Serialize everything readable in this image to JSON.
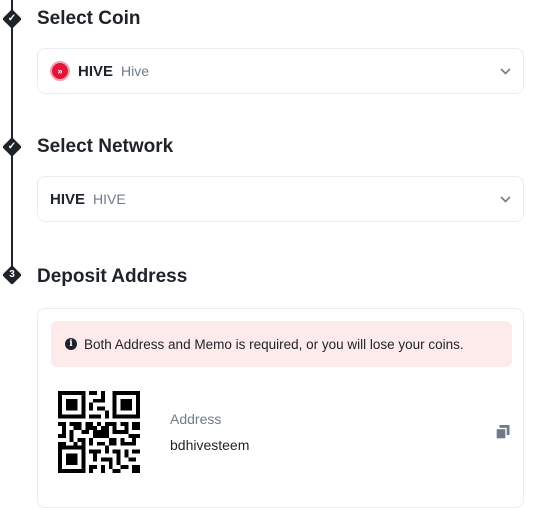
{
  "steps": [
    {
      "marker": "check",
      "title": "Select Coin"
    },
    {
      "marker": "check",
      "title": "Select Network"
    },
    {
      "marker": "3",
      "title": "Deposit Address"
    }
  ],
  "coin_select": {
    "symbol": "HIVE",
    "name": "Hive",
    "icon": "hive-logo-icon",
    "icon_color": "#e31337"
  },
  "network_select": {
    "symbol": "HIVE",
    "name": "HIVE"
  },
  "deposit": {
    "warning": "Both Address and Memo is required, or you will lose your coins.",
    "address_label": "Address",
    "address_value": "bdhivesteem"
  },
  "colors": {
    "text": "#1e2329",
    "muted": "#707a8a",
    "warning_bg": "#fdeaea",
    "border": "#eaecef"
  }
}
